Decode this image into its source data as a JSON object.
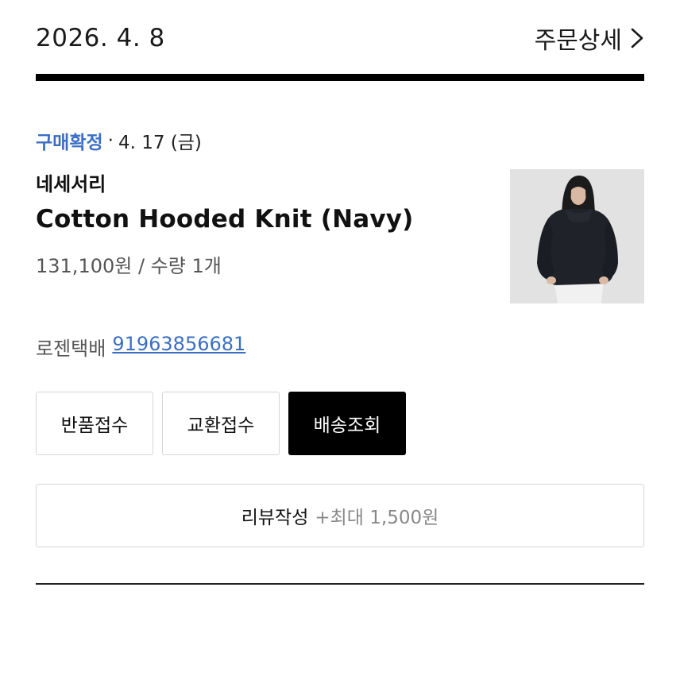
{
  "header": {
    "order_date": "2026. 4. 8",
    "order_detail_label": "주문상세"
  },
  "order": {
    "status": "구매확정",
    "status_separator": "·",
    "status_date": "4. 17 (금)",
    "brand": "네세서리",
    "product_name": "Cotton Hooded Knit (Navy)",
    "price_quantity": "131,100원 / 수량 1개",
    "courier": "로젠택배",
    "tracking_number": "91963856681"
  },
  "actions": {
    "return_label": "반품접수",
    "exchange_label": "교환접수",
    "tracking_label": "배송조회"
  },
  "review": {
    "label": "리뷰작성",
    "reward": "+최대 1,500원"
  },
  "colors": {
    "accent_blue": "#3a6fc4",
    "dark_button": "#000000"
  }
}
